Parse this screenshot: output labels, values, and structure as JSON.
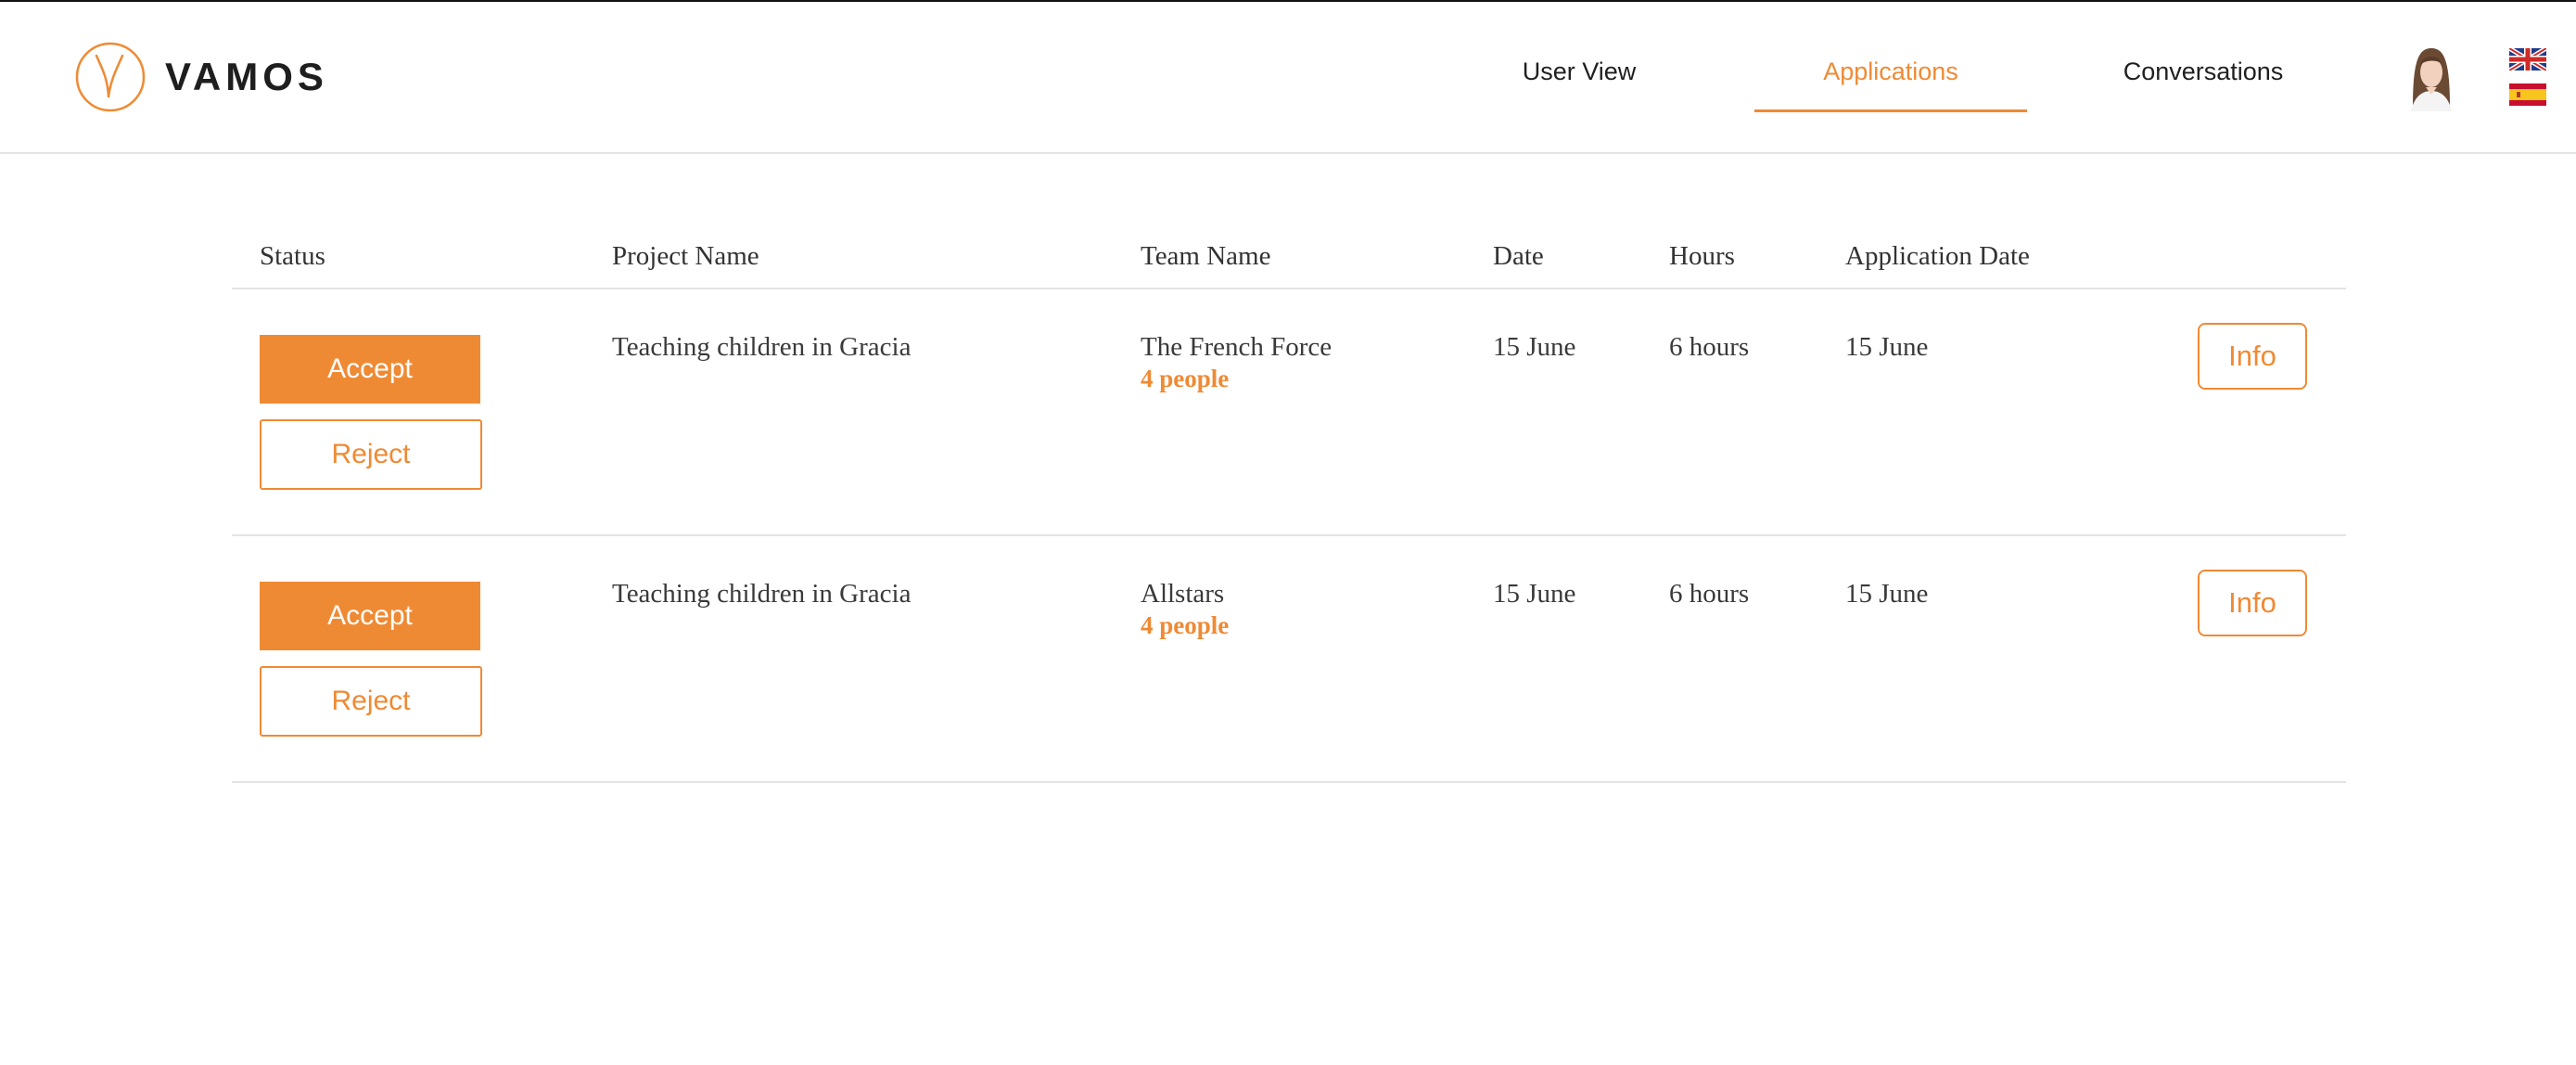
{
  "brand": {
    "name": "VAMOS",
    "accent_color": "#ef8a34"
  },
  "nav": {
    "items": [
      {
        "label": "User View"
      },
      {
        "label": "Applications",
        "active": true
      },
      {
        "label": "Conversations"
      }
    ]
  },
  "header_icons": {
    "avatar": "user-avatar",
    "languages": [
      "english-flag-icon",
      "spanish-flag-icon"
    ]
  },
  "table": {
    "columns": [
      "Status",
      "Project Name",
      "Team Name",
      "Date",
      "Hours",
      "Application Date"
    ],
    "rows": [
      {
        "accept_label": "Accept",
        "reject_label": "Reject",
        "project": "Teaching children in Gracia",
        "team": "The French Force",
        "team_size": "4 people",
        "date": "15 June",
        "hours": "6 hours",
        "application_date": "15 June",
        "info_label": "Info"
      },
      {
        "accept_label": "Accept",
        "reject_label": "Reject",
        "project": "Teaching children in Gracia",
        "team": "Allstars",
        "team_size": "4 people",
        "date": "15 June",
        "hours": "6 hours",
        "application_date": "15 June",
        "info_label": "Info"
      }
    ]
  }
}
